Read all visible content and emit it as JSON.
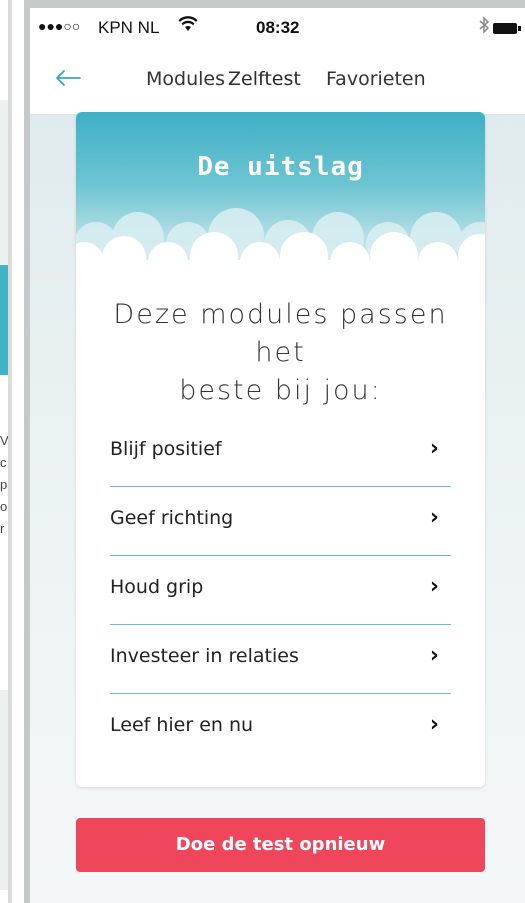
{
  "status_bar": {
    "signal": "●●●○○",
    "carrier": "KPN NL",
    "wifi_icon": "wifi-icon",
    "time": "08:32",
    "bluetooth_icon": "bluetooth-icon",
    "battery_icon": "battery-icon"
  },
  "nav": {
    "back_icon": "arrow-left-icon",
    "back_glyph": "←",
    "tabs": [
      {
        "label": "Modules"
      },
      {
        "label": "Zelftest"
      },
      {
        "label": "Favorieten"
      }
    ],
    "active_tab": "Zelftest"
  },
  "card": {
    "title": "De uitslag",
    "heading_lines": [
      "Deze modules passen",
      "het",
      "beste bij jou:"
    ],
    "modules": [
      {
        "label": "Blijf positief"
      },
      {
        "label": "Geef richting"
      },
      {
        "label": "Houd grip"
      },
      {
        "label": "Investeer in relaties"
      },
      {
        "label": "Leef hier en nu"
      }
    ],
    "chevron_icon": "chevron-right-icon",
    "chevron_glyph": "›"
  },
  "retry_button": {
    "label": "Doe de test opnieuw"
  },
  "left_panel": {
    "text_fragments": [
      "V",
      "c",
      "p",
      "o",
      "r"
    ]
  },
  "colors": {
    "accent": "#3ba9bf",
    "button": "#f0465c",
    "header_top": "#3fb0c4"
  }
}
